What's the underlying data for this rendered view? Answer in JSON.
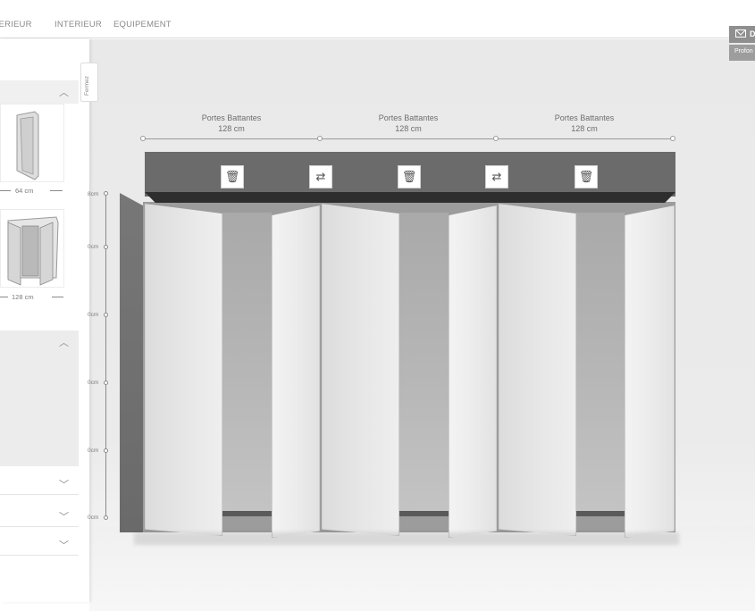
{
  "nav": {
    "tabs": [
      "XTERIEUR",
      "INTERIEUR",
      "EQUIPEMENT"
    ]
  },
  "right_buttons": {
    "contact_label": "D",
    "profile_label": "Profon"
  },
  "panel": {
    "fermer_label": "Fermez",
    "thumb1_width": "64 cm",
    "thumb2_width": "128 cm"
  },
  "modules": [
    {
      "title": "Portes Battantes",
      "width": "128 cm"
    },
    {
      "title": "Portes Battantes",
      "width": "128 cm"
    },
    {
      "title": "Portes Battantes",
      "width": "128 cm"
    }
  ],
  "actions": [
    "trash-icon",
    "swap-icon",
    "trash-icon",
    "swap-icon",
    "trash-icon"
  ],
  "ruler_labels": [
    "8cm",
    "0cm",
    "0cm",
    "0cm",
    "0cm",
    "0cm"
  ]
}
